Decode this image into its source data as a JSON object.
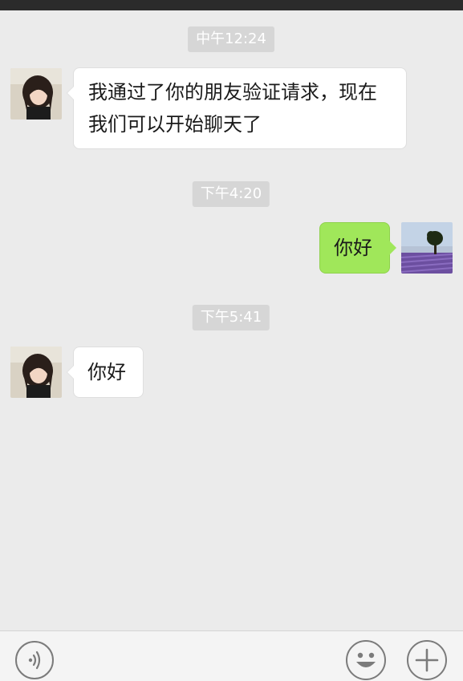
{
  "messages": [
    {
      "type": "time",
      "text": "中午12:24"
    },
    {
      "type": "message",
      "side": "left",
      "text": "我通过了你的朋友验证请求，现在\n我们可以开始聊天了"
    },
    {
      "type": "time",
      "text": "下午4:20"
    },
    {
      "type": "message",
      "side": "right",
      "text": "你好"
    },
    {
      "type": "time",
      "text": "下午5:41"
    },
    {
      "type": "message",
      "side": "left",
      "text": "你好"
    }
  ],
  "input_bar": {
    "voice_icon": "voice-wave-icon",
    "emoji_icon": "smiley-face-icon",
    "more_icon": "plus-icon"
  },
  "colors": {
    "chat_background": "#ebebeb",
    "time_badge": "#d6d6d6",
    "incoming_bubble": "#ffffff",
    "outgoing_bubble": "#a0e75a",
    "status_bar": "#2b2b2b"
  }
}
